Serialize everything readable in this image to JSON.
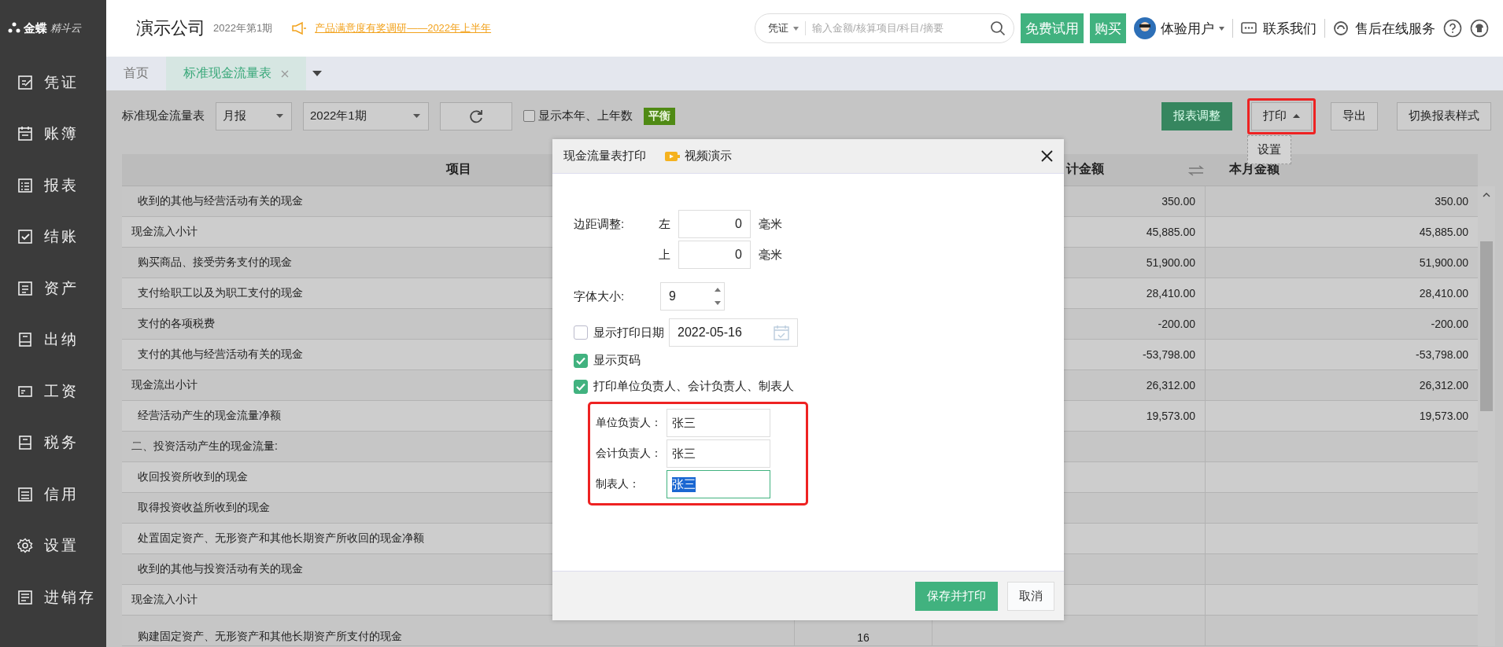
{
  "brand": {
    "logo_main": "金蝶",
    "logo_sub": "精斗云"
  },
  "sidebar": {
    "items": [
      {
        "label": "凭证"
      },
      {
        "label": "账簿"
      },
      {
        "label": "报表"
      },
      {
        "label": "结账"
      },
      {
        "label": "资产"
      },
      {
        "label": "出纳"
      },
      {
        "label": "工资"
      },
      {
        "label": "税务"
      },
      {
        "label": "信用"
      },
      {
        "label": "设置"
      },
      {
        "label": "进销存"
      }
    ]
  },
  "header": {
    "company": "演示公司",
    "period": "2022年第1期",
    "notice": "产品满意度有奖调研——2022年上半年",
    "search": {
      "scope": "凭证",
      "placeholder": "输入金额/核算项目/科目/摘要"
    },
    "buttons": [
      "免费试用",
      "购买"
    ],
    "user": "体验用户",
    "links": [
      "联系我们",
      "售后在线服务"
    ]
  },
  "tabs": [
    {
      "label": "首页",
      "selected": false,
      "closable": false
    },
    {
      "label": "标准现金流量表",
      "selected": true,
      "closable": true
    }
  ],
  "toolbar": {
    "title": "标准现金流量表",
    "period_type": "月报",
    "period": "2022年1期",
    "show_years": {
      "label": "显示本年、上年数",
      "checked": false
    },
    "status": "平衡",
    "buttons": [
      {
        "label": "报表调整",
        "kind": "primary",
        "highlighted": false
      },
      {
        "label": "打印",
        "kind": "menu",
        "highlighted": true
      },
      {
        "label": "导出",
        "kind": "plain",
        "highlighted": false
      },
      {
        "label": "切换报表样式",
        "kind": "plain",
        "highlighted": false
      }
    ],
    "menu": [
      "设置"
    ]
  },
  "table": {
    "headers": {
      "item": "项目",
      "column_3": "计金额",
      "column_4": "本月金额"
    },
    "rows": [
      {
        "kind": "item",
        "item": "收到的其他与经营活动有关的现金",
        "column_3": "350.00",
        "column_4": "350.00"
      },
      {
        "kind": "subtotal",
        "item": "现金流入小计",
        "column_3": "45,885.00",
        "column_4": "45,885.00"
      },
      {
        "kind": "item",
        "item": "购买商品、接受劳务支付的现金",
        "column_3": "51,900.00",
        "column_4": "51,900.00"
      },
      {
        "kind": "item",
        "item": "支付给职工以及为职工支付的现金",
        "column_3": "28,410.00",
        "column_4": "28,410.00"
      },
      {
        "kind": "item",
        "item": "支付的各项税费",
        "column_3": "-200.00",
        "column_4": "-200.00"
      },
      {
        "kind": "item",
        "item": "支付的其他与经营活动有关的现金",
        "column_3": "-53,798.00",
        "column_4": "-53,798.00"
      },
      {
        "kind": "subtotal",
        "item": "现金流出小计",
        "column_3": "26,312.00",
        "column_4": "26,312.00"
      },
      {
        "kind": "item",
        "item": "经营活动产生的现金流量净额",
        "column_3": "19,573.00",
        "column_4": "19,573.00"
      },
      {
        "kind": "subtotal",
        "item": "二、投资活动产生的现金流量:"
      },
      {
        "kind": "item",
        "item": "收回投资所收到的现金"
      },
      {
        "kind": "item",
        "item": "取得投资收益所收到的现金"
      },
      {
        "kind": "item",
        "item": "处置固定资产、无形资产和其他长期资产所收回的现金净额"
      },
      {
        "kind": "item",
        "item": "收到的其他与投资活动有关的现金"
      },
      {
        "kind": "subtotal",
        "item": "现金流入小计"
      },
      {
        "kind": "item",
        "item": "购建固定资产、无形资产和其他长期资产所支付的现金",
        "column_2": "16"
      }
    ]
  },
  "dialog": {
    "title": "现金流量表打印",
    "video_link": "视频演示",
    "margin_label": "边距调整:",
    "margins": [
      {
        "side": "左",
        "value": "0",
        "unit": "毫米"
      },
      {
        "side": "上",
        "value": "0",
        "unit": "毫米"
      }
    ],
    "font_size_label": "字体大小:",
    "font_size": "9",
    "options": [
      {
        "label": "显示打印日期",
        "checked": false,
        "date": "2022-05-16"
      },
      {
        "label": "显示页码",
        "checked": true
      },
      {
        "label": "打印单位负责人、会计负责人、制表人",
        "checked": true
      }
    ],
    "signers": {
      "highlighted": true,
      "fields": [
        {
          "label": "单位负责人：",
          "value": "张三",
          "focused": false
        },
        {
          "label": "会计负责人：",
          "value": "张三",
          "focused": false
        },
        {
          "label": "制表人：",
          "value": "张三",
          "focused": true
        }
      ]
    },
    "buttons": [
      {
        "label": "保存并打印",
        "kind": "primary"
      },
      {
        "label": "取消",
        "kind": "plain"
      }
    ]
  }
}
